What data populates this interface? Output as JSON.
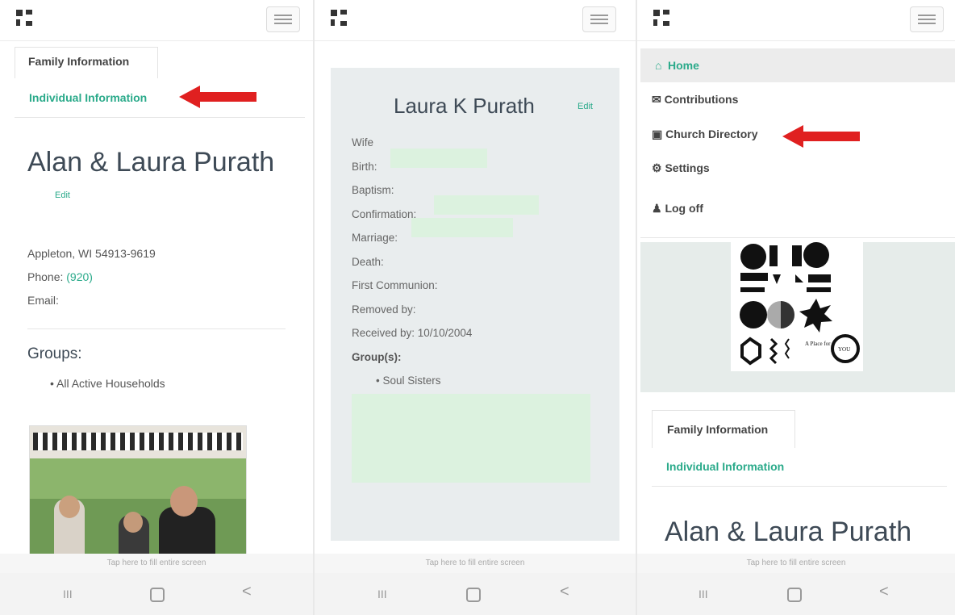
{
  "panel1": {
    "tab_family": "Family Information",
    "tab_individual": "Individual Information",
    "family_name": "Alan & Laura Purath",
    "edit": "Edit",
    "address": "Appleton, WI 54913-9619",
    "phone_label": "Phone:",
    "phone_value": "(920)",
    "email_label": "Email:",
    "groups_heading": "Groups:",
    "groups": [
      "All Active Households"
    ],
    "hint": "Tap here to fill entire screen"
  },
  "panel2": {
    "name": "Laura K Purath",
    "edit": "Edit",
    "fields": {
      "role": "Wife",
      "birth": "Birth:",
      "baptism": "Baptism:",
      "confirmation": "Confirmation:",
      "marriage": "Marriage:",
      "death": "Death:",
      "first_communion": "First Communion:",
      "removed_by": "Removed by:",
      "received_by": "Received by: 10/10/2004",
      "groups": "Group(s):"
    },
    "groups": [
      "Soul Sisters"
    ],
    "hint": "Tap here to fill entire screen"
  },
  "panel3": {
    "menu": {
      "home": "Home",
      "contributions": "Contributions",
      "directory": "Church Directory",
      "settings": "Settings",
      "logoff": "Log off"
    },
    "badge_text_a": "A Place for",
    "badge_text_b": "YOU",
    "tab_family": "Family Information",
    "tab_individual": "Individual Information",
    "family_name": "Alan & Laura Purath",
    "hint": "Tap here to fill entire screen"
  },
  "nav": {
    "recent": "III",
    "back": "<"
  },
  "colors": {
    "accent": "#2aaa8a",
    "arrow": "#e02020",
    "card_bg": "#e9edee"
  }
}
